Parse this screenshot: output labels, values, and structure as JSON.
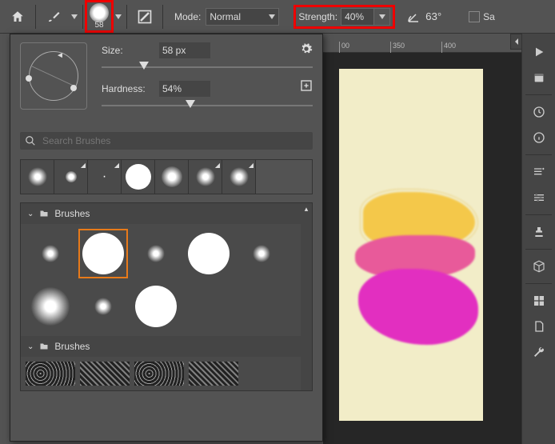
{
  "toolbar": {
    "home_icon": "home-icon",
    "brush_size_display": "58",
    "mode_label": "Mode:",
    "mode_value": "Normal",
    "strength_label": "Strength:",
    "strength_value": "40%",
    "angle_value": "63°",
    "sample_label": "Sa"
  },
  "panel": {
    "size_label": "Size:",
    "size_value": "58 px",
    "hardness_label": "Hardness:",
    "hardness_value": "54%",
    "search_placeholder": "Search Brushes",
    "folder1_label": "Brushes",
    "folder2_label": "Brushes"
  },
  "ruler": {
    "t1": "00",
    "t2": "350",
    "t3": "400"
  }
}
